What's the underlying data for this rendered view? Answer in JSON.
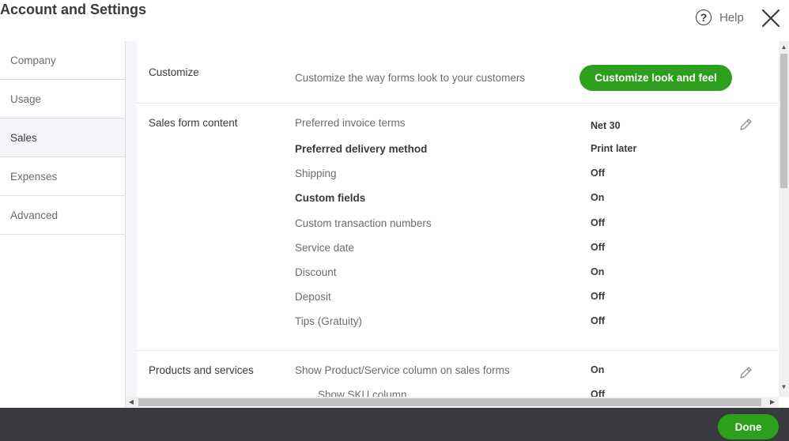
{
  "header": {
    "title": "Account and Settings",
    "help_label": "Help",
    "help_glyph": "?",
    "help_icon": "question-circle-icon",
    "close_icon": "close-x-icon"
  },
  "sidebar": {
    "items": [
      {
        "label": "Company",
        "active": false
      },
      {
        "label": "Usage",
        "active": false
      },
      {
        "label": "Sales",
        "active": true
      },
      {
        "label": "Expenses",
        "active": false
      },
      {
        "label": "Advanced",
        "active": false
      }
    ]
  },
  "customize": {
    "label": "Customize",
    "description": "Customize the way forms look to your customers",
    "button_label": "Customize look and feel"
  },
  "sales_form": {
    "label": "Sales form content",
    "rows": [
      {
        "label": "Preferred invoice terms",
        "value": "Net 30"
      },
      {
        "label": "Preferred delivery method",
        "value": "Print later"
      },
      {
        "label": "Shipping",
        "value": "Off"
      },
      {
        "label": "Custom fields",
        "value": "On"
      },
      {
        "label": "Custom transaction numbers",
        "value": "Off"
      },
      {
        "label": "Service date",
        "value": "Off"
      },
      {
        "label": "Discount",
        "value": "On"
      },
      {
        "label": "Deposit",
        "value": "Off"
      },
      {
        "label": "Tips (Gratuity)",
        "value": "Off"
      }
    ]
  },
  "products": {
    "label": "Products and services",
    "rows": [
      {
        "label": "Show Product/Service column on sales forms",
        "value": "On"
      },
      {
        "label": "Show SKU column",
        "value": "Off"
      }
    ]
  },
  "footer": {
    "done_label": "Done"
  },
  "colors": {
    "accent_green": "#2ca01c",
    "footer_bg": "#393a3d",
    "active_nav_bg": "#f4f5f8"
  }
}
